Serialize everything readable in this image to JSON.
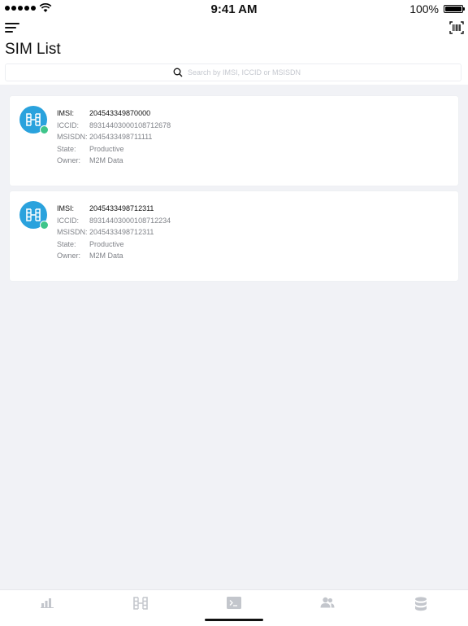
{
  "status_bar": {
    "time": "9:41 AM",
    "battery": "100%"
  },
  "header": {
    "title": "SIM List",
    "search_placeholder": "Search by IMSI, ICCID or MSISDN"
  },
  "labels": {
    "imsi": "IMSI:",
    "iccid": "ICCID:",
    "msisdn": "MSISDN:",
    "state": "State:",
    "owner": "Owner:"
  },
  "sims": [
    {
      "imsi": "204543349870000",
      "iccid": "89314403000108712678",
      "msisdn": "2045433498711111",
      "state": "Productive",
      "owner": "M2M Data",
      "status_color": "#3ec58a"
    },
    {
      "imsi": "2045433498712311",
      "iccid": "89314403000108712234",
      "msisdn": "2045433498712311",
      "state": "Productive",
      "owner": "M2M Data",
      "status_color": "#3ec58a"
    }
  ],
  "tabs": [
    {
      "icon": "bar-chart-icon"
    },
    {
      "icon": "sim-icon"
    },
    {
      "icon": "terminal-icon"
    },
    {
      "icon": "users-icon"
    },
    {
      "icon": "database-icon"
    }
  ],
  "colors": {
    "accent": "#2aa2dd",
    "status_active": "#3ec58a",
    "background": "#f1f2f6",
    "inactive_tab": "#c3c6cc"
  }
}
